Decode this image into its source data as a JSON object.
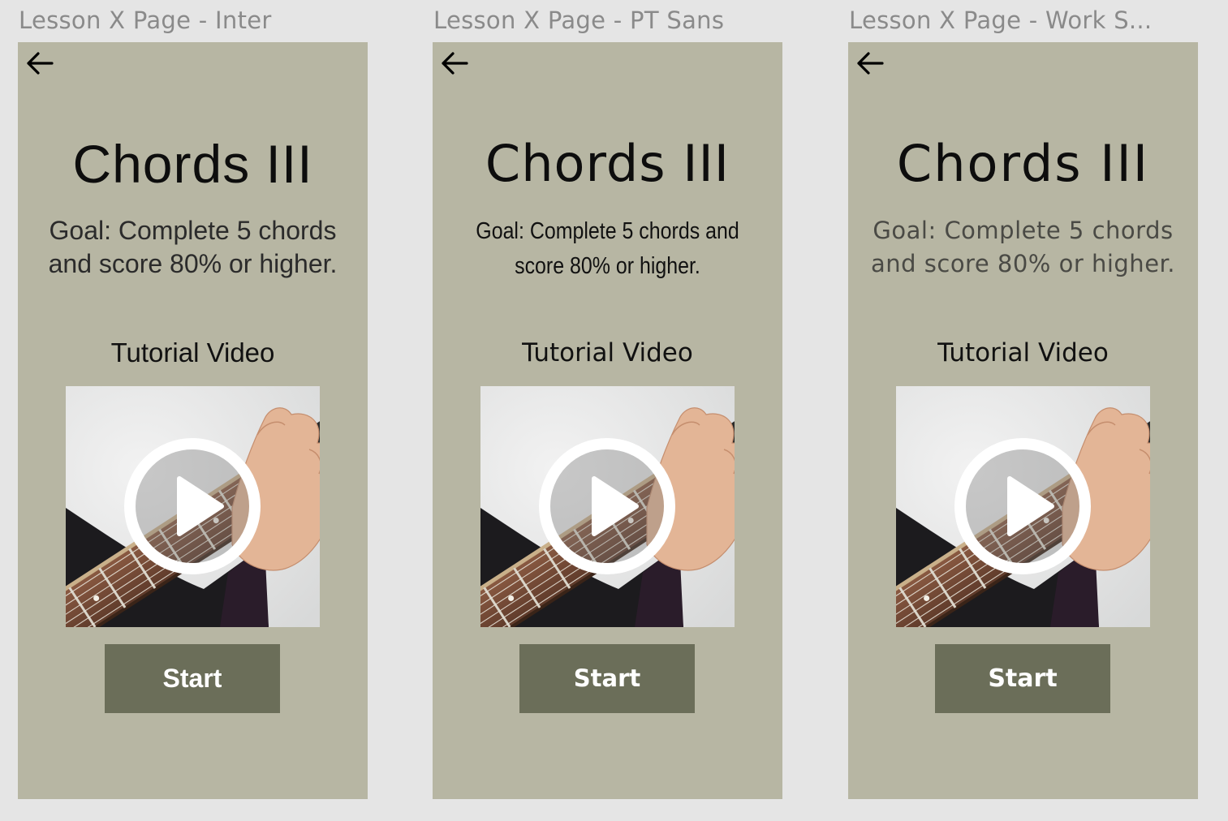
{
  "canvas": {
    "background": "#e5e5e5"
  },
  "frames": [
    {
      "label": "Lesson X Page - Inter",
      "back_icon": "arrow-left-icon",
      "title": "Chords III",
      "goal": "Goal: Complete 5 chords and score 80% or higher.",
      "video_heading": "Tutorial Video",
      "video_icon": "play-icon",
      "start_label": "Start"
    },
    {
      "label": "Lesson X Page - PT Sans",
      "back_icon": "arrow-left-icon",
      "title": "Chords III",
      "goal": "Goal: Complete 5 chords and score 80% or higher.",
      "video_heading": "Tutorial Video",
      "video_icon": "play-icon",
      "start_label": "Start"
    },
    {
      "label": "Lesson X Page - Work S...",
      "back_icon": "arrow-left-icon",
      "title": "Chords III",
      "goal": "Goal: Complete 5 chords and score 80% or higher.",
      "video_heading": "Tutorial Video",
      "video_icon": "play-icon",
      "start_label": "Start"
    }
  ],
  "colors": {
    "frame_background": "#b7b6a3",
    "button_background": "#6b6e59",
    "button_text": "#ffffff",
    "label_text": "#8a8a8a"
  }
}
